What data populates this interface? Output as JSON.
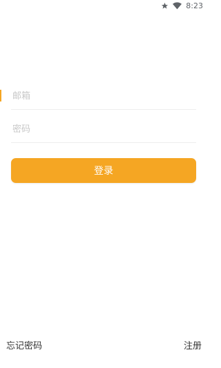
{
  "status_bar": {
    "time": "8:23",
    "icons": [
      "star-icon",
      "wifi-icon"
    ]
  },
  "form": {
    "email_placeholder": "邮箱",
    "password_placeholder": "密码"
  },
  "login_button": {
    "label": "登录"
  },
  "links": {
    "forgot_password": "忘记密码",
    "register": "注册"
  },
  "colors": {
    "accent": "#f5a623",
    "text": "#333333",
    "placeholder": "#c8c8c8"
  }
}
